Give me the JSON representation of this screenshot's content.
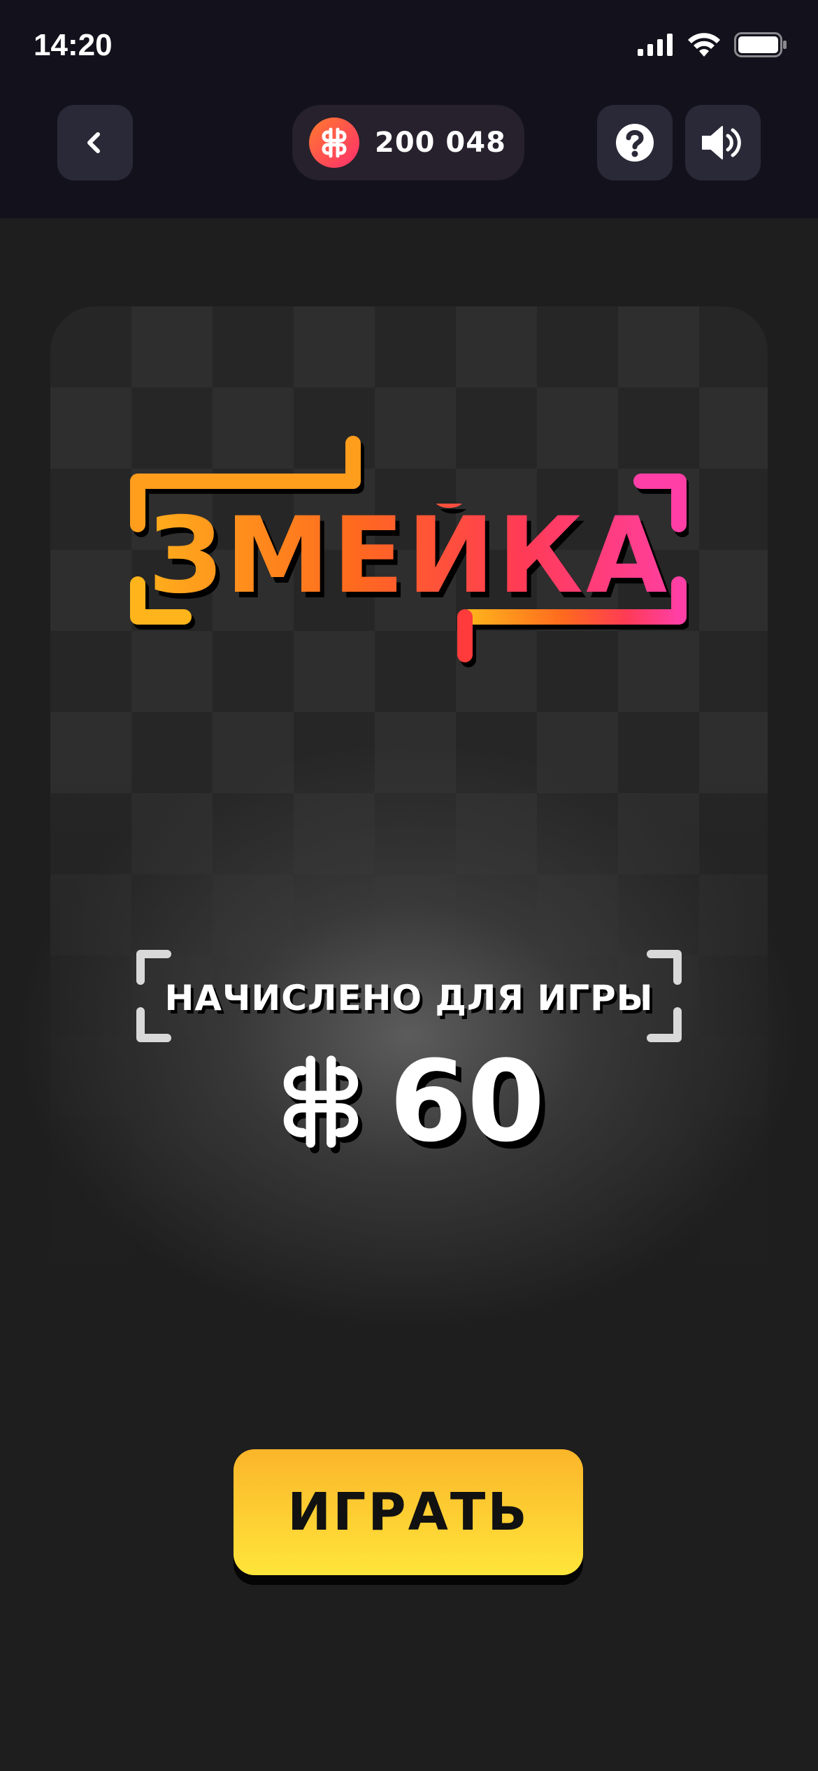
{
  "status_bar": {
    "time": "14:20"
  },
  "header": {
    "balance": "200 048"
  },
  "game": {
    "title": "ЗМЕЙКА",
    "credited_label": "НАЧИСЛЕНО ДЛЯ ИГРЫ",
    "credited_amount": "60",
    "play_label": "ИГРАТЬ"
  },
  "colors": {
    "logo_gradient": [
      "#ffb41c",
      "#ff6a1e",
      "#ff3b55",
      "#ff3fa6"
    ],
    "play_button": "#ffd22e",
    "header_bg": "#13121c"
  },
  "icons": [
    "back-icon",
    "coin-icon",
    "help-icon",
    "sound-icon",
    "signal-icon",
    "wifi-icon",
    "battery-icon"
  ]
}
